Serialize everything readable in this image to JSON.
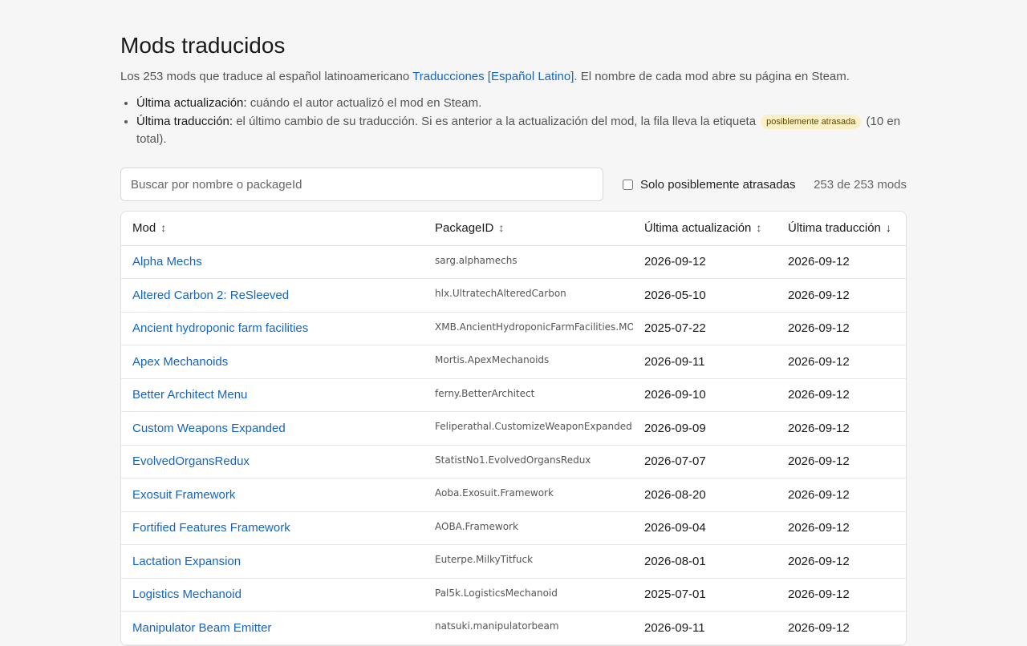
{
  "page": {
    "title": "Mods traducidos",
    "intro_before": "Los 253 mods que traduce al español latinoamericano ",
    "intro_link": "Traducciones [Español Latino]",
    "intro_after": ". El nombre de cada mod abre su página en Steam.",
    "notes": [
      {
        "term": "Última actualización:",
        "text": " cuándo el autor actualizó el mod en Steam."
      },
      {
        "term": "Última traducción:",
        "text": " el último cambio de su traducción. Si es anterior a la actualización del mod, la fila lleva la etiqueta",
        "badge": "posiblemente atrasada",
        "after": " (10 en total)."
      }
    ]
  },
  "toolbar": {
    "search_placeholder": "Buscar por nombre o packageId",
    "filter_label": "Solo posiblemente atrasadas",
    "count": "253 de 253 mods"
  },
  "table": {
    "columns": [
      {
        "label": "Mod",
        "arrow": "↕",
        "active": false
      },
      {
        "label": "PackageID",
        "arrow": "↕",
        "active": false
      },
      {
        "label": "Última actualización",
        "arrow": "↕",
        "active": false
      },
      {
        "label": "Última traducción",
        "arrow": "↓",
        "active": true
      }
    ],
    "rows": [
      {
        "mod": "Alpha Mechs",
        "pkg": "sarg.alphamechs",
        "updated": "2026-09-12",
        "translated": "2026-09-12"
      },
      {
        "mod": "Altered Carbon 2: ReSleeved",
        "pkg": "hlx.UltratechAlteredCarbon",
        "updated": "2026-05-10",
        "translated": "2026-09-12"
      },
      {
        "mod": "Ancient hydroponic farm facilities",
        "pkg": "XMB.AncientHydroponicFarmFacilities.MO",
        "updated": "2025-07-22",
        "translated": "2026-09-12"
      },
      {
        "mod": "Apex Mechanoids",
        "pkg": "Mortis.ApexMechanoids",
        "updated": "2026-09-11",
        "translated": "2026-09-12"
      },
      {
        "mod": "Better Architect Menu",
        "pkg": "ferny.BetterArchitect",
        "updated": "2026-09-10",
        "translated": "2026-09-12"
      },
      {
        "mod": "Custom Weapons Expanded",
        "pkg": "Feliperathal.CustomizeWeaponExpanded",
        "updated": "2026-09-09",
        "translated": "2026-09-12"
      },
      {
        "mod": "EvolvedOrgansRedux",
        "pkg": "StatistNo1.EvolvedOrgansRedux",
        "updated": "2026-07-07",
        "translated": "2026-09-12"
      },
      {
        "mod": "Exosuit Framework",
        "pkg": "Aoba.Exosuit.Framework",
        "updated": "2026-08-20",
        "translated": "2026-09-12"
      },
      {
        "mod": "Fortified Features Framework",
        "pkg": "AOBA.Framework",
        "updated": "2026-09-04",
        "translated": "2026-09-12"
      },
      {
        "mod": "Lactation Expansion",
        "pkg": "Euterpe.MilkyTitfuck",
        "updated": "2026-08-01",
        "translated": "2026-09-12"
      },
      {
        "mod": "Logistics Mechanoid",
        "pkg": "Pal5k.LogisticsMechanoid",
        "updated": "2025-07-01",
        "translated": "2026-09-12"
      },
      {
        "mod": "Manipulator Beam Emitter",
        "pkg": "natsuki.manipulatorbeam",
        "updated": "2026-09-11",
        "translated": "2026-09-12"
      }
    ]
  }
}
